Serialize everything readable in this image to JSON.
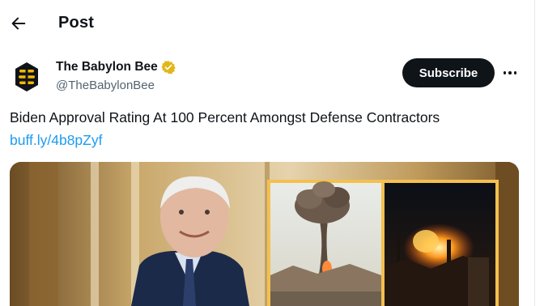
{
  "header": {
    "title": "Post",
    "back_icon": "arrow-left-icon"
  },
  "author": {
    "name": "The Babylon Bee",
    "handle": "@TheBabylonBee",
    "verified_color": "#e2b719",
    "avatar_icon": "bee-logo-icon"
  },
  "actions": {
    "subscribe_label": "Subscribe",
    "more_icon": "more-icon"
  },
  "post": {
    "text": "Biden Approval Rating At 100 Percent Amongst Defense Contractors",
    "link": "buff.ly/4b8pZyf"
  },
  "colors": {
    "accent": "#1d9bf0",
    "primary_text": "#0f1419",
    "secondary_text": "#536471"
  }
}
